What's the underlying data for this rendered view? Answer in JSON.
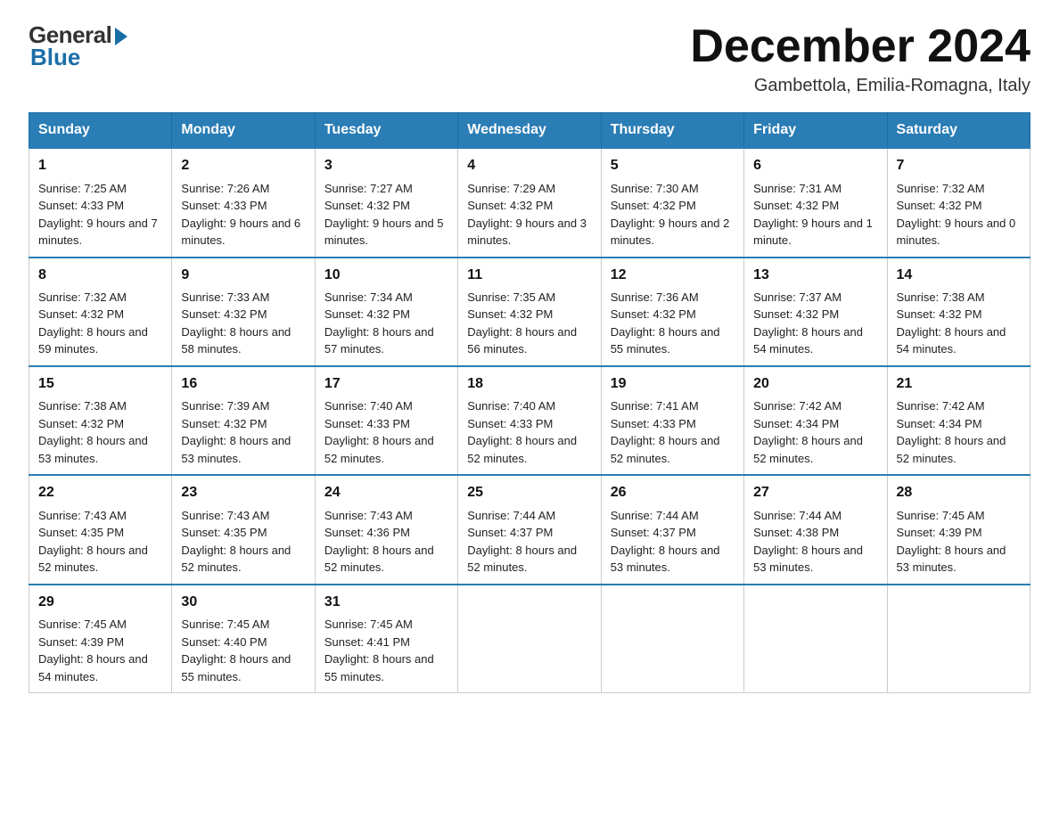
{
  "logo": {
    "general": "General",
    "blue": "Blue"
  },
  "title": "December 2024",
  "subtitle": "Gambettola, Emilia-Romagna, Italy",
  "days_of_week": [
    "Sunday",
    "Monday",
    "Tuesday",
    "Wednesday",
    "Thursday",
    "Friday",
    "Saturday"
  ],
  "weeks": [
    [
      {
        "day": "1",
        "sunrise": "7:25 AM",
        "sunset": "4:33 PM",
        "daylight": "9 hours and 7 minutes."
      },
      {
        "day": "2",
        "sunrise": "7:26 AM",
        "sunset": "4:33 PM",
        "daylight": "9 hours and 6 minutes."
      },
      {
        "day": "3",
        "sunrise": "7:27 AM",
        "sunset": "4:32 PM",
        "daylight": "9 hours and 5 minutes."
      },
      {
        "day": "4",
        "sunrise": "7:29 AM",
        "sunset": "4:32 PM",
        "daylight": "9 hours and 3 minutes."
      },
      {
        "day": "5",
        "sunrise": "7:30 AM",
        "sunset": "4:32 PM",
        "daylight": "9 hours and 2 minutes."
      },
      {
        "day": "6",
        "sunrise": "7:31 AM",
        "sunset": "4:32 PM",
        "daylight": "9 hours and 1 minute."
      },
      {
        "day": "7",
        "sunrise": "7:32 AM",
        "sunset": "4:32 PM",
        "daylight": "9 hours and 0 minutes."
      }
    ],
    [
      {
        "day": "8",
        "sunrise": "7:32 AM",
        "sunset": "4:32 PM",
        "daylight": "8 hours and 59 minutes."
      },
      {
        "day": "9",
        "sunrise": "7:33 AM",
        "sunset": "4:32 PM",
        "daylight": "8 hours and 58 minutes."
      },
      {
        "day": "10",
        "sunrise": "7:34 AM",
        "sunset": "4:32 PM",
        "daylight": "8 hours and 57 minutes."
      },
      {
        "day": "11",
        "sunrise": "7:35 AM",
        "sunset": "4:32 PM",
        "daylight": "8 hours and 56 minutes."
      },
      {
        "day": "12",
        "sunrise": "7:36 AM",
        "sunset": "4:32 PM",
        "daylight": "8 hours and 55 minutes."
      },
      {
        "day": "13",
        "sunrise": "7:37 AM",
        "sunset": "4:32 PM",
        "daylight": "8 hours and 54 minutes."
      },
      {
        "day": "14",
        "sunrise": "7:38 AM",
        "sunset": "4:32 PM",
        "daylight": "8 hours and 54 minutes."
      }
    ],
    [
      {
        "day": "15",
        "sunrise": "7:38 AM",
        "sunset": "4:32 PM",
        "daylight": "8 hours and 53 minutes."
      },
      {
        "day": "16",
        "sunrise": "7:39 AM",
        "sunset": "4:32 PM",
        "daylight": "8 hours and 53 minutes."
      },
      {
        "day": "17",
        "sunrise": "7:40 AM",
        "sunset": "4:33 PM",
        "daylight": "8 hours and 52 minutes."
      },
      {
        "day": "18",
        "sunrise": "7:40 AM",
        "sunset": "4:33 PM",
        "daylight": "8 hours and 52 minutes."
      },
      {
        "day": "19",
        "sunrise": "7:41 AM",
        "sunset": "4:33 PM",
        "daylight": "8 hours and 52 minutes."
      },
      {
        "day": "20",
        "sunrise": "7:42 AM",
        "sunset": "4:34 PM",
        "daylight": "8 hours and 52 minutes."
      },
      {
        "day": "21",
        "sunrise": "7:42 AM",
        "sunset": "4:34 PM",
        "daylight": "8 hours and 52 minutes."
      }
    ],
    [
      {
        "day": "22",
        "sunrise": "7:43 AM",
        "sunset": "4:35 PM",
        "daylight": "8 hours and 52 minutes."
      },
      {
        "day": "23",
        "sunrise": "7:43 AM",
        "sunset": "4:35 PM",
        "daylight": "8 hours and 52 minutes."
      },
      {
        "day": "24",
        "sunrise": "7:43 AM",
        "sunset": "4:36 PM",
        "daylight": "8 hours and 52 minutes."
      },
      {
        "day": "25",
        "sunrise": "7:44 AM",
        "sunset": "4:37 PM",
        "daylight": "8 hours and 52 minutes."
      },
      {
        "day": "26",
        "sunrise": "7:44 AM",
        "sunset": "4:37 PM",
        "daylight": "8 hours and 53 minutes."
      },
      {
        "day": "27",
        "sunrise": "7:44 AM",
        "sunset": "4:38 PM",
        "daylight": "8 hours and 53 minutes."
      },
      {
        "day": "28",
        "sunrise": "7:45 AM",
        "sunset": "4:39 PM",
        "daylight": "8 hours and 53 minutes."
      }
    ],
    [
      {
        "day": "29",
        "sunrise": "7:45 AM",
        "sunset": "4:39 PM",
        "daylight": "8 hours and 54 minutes."
      },
      {
        "day": "30",
        "sunrise": "7:45 AM",
        "sunset": "4:40 PM",
        "daylight": "8 hours and 55 minutes."
      },
      {
        "day": "31",
        "sunrise": "7:45 AM",
        "sunset": "4:41 PM",
        "daylight": "8 hours and 55 minutes."
      },
      null,
      null,
      null,
      null
    ]
  ]
}
